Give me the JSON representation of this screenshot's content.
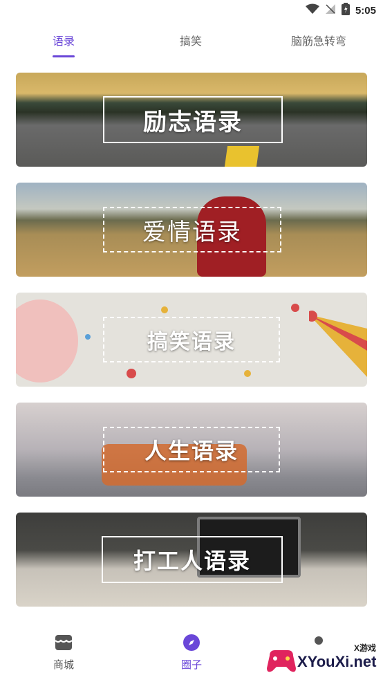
{
  "status_bar": {
    "time": "5:05",
    "icons": [
      "wifi-icon",
      "signal-icon",
      "battery-icon"
    ]
  },
  "tabs": [
    {
      "label": "语录",
      "active": true
    },
    {
      "label": "搞笑",
      "active": false
    },
    {
      "label": "脑筋急转弯",
      "active": false
    }
  ],
  "cards": [
    {
      "label": "励志语录"
    },
    {
      "label": "爱情语录"
    },
    {
      "label": "搞笑语录"
    },
    {
      "label": "人生语录"
    },
    {
      "label": "打工人语录"
    }
  ],
  "bottom_nav": [
    {
      "label": "商城",
      "icon": "store-icon",
      "active": false
    },
    {
      "label": "圈子",
      "icon": "compass-icon",
      "active": true
    }
  ],
  "watermark": {
    "top_text": "X游戏",
    "main_text": "XYouXi.net"
  },
  "colors": {
    "accent": "#6a47d8",
    "text_muted": "#666666"
  }
}
